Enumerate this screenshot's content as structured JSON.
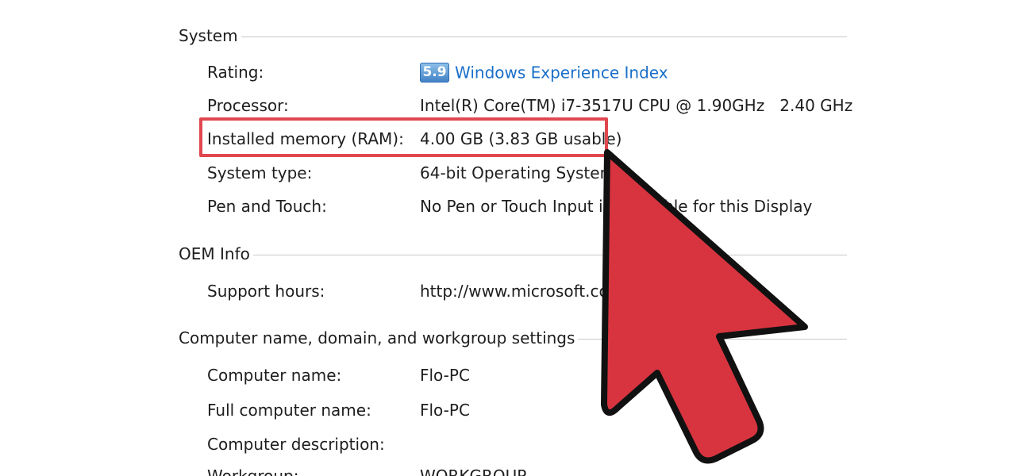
{
  "sections": {
    "system": {
      "title": "System",
      "rating_label": "Rating:",
      "rating_score": "5.9",
      "rating_link": "Windows Experience Index",
      "processor_label": "Processor:",
      "processor_value": "Intel(R) Core(TM) i7-3517U CPU @ 1.90GHz   2.40 GHz",
      "memory_label": "Installed memory (RAM):",
      "memory_value": "4.00 GB (3.83 GB usable)",
      "system_type_label": "System type:",
      "system_type_value": "64-bit Operating System",
      "pen_touch_label": "Pen and Touch:",
      "pen_touch_value": "No Pen or Touch Input is available for this Display"
    },
    "oem": {
      "title": "OEM Info",
      "support_hours_label": "Support hours:",
      "support_hours_value": "http://www.microsoft.com"
    },
    "computer_name": {
      "title": "Computer name, domain, and workgroup settings",
      "computer_name_label": "Computer name:",
      "computer_name_value": "Flo-PC",
      "full_name_label": "Full computer name:",
      "full_name_value": "Flo-PC",
      "description_label": "Computer description:",
      "description_value": "",
      "workgroup_label": "Workgroup:",
      "workgroup_value": "WORKGROUP"
    }
  },
  "colors": {
    "highlight": "#e0474f",
    "arrow_fill": "#d8343f",
    "link": "#1a6fc9"
  },
  "icons": {
    "pointer": "arrow-pointer-icon",
    "rating": "rating-badge-icon"
  }
}
